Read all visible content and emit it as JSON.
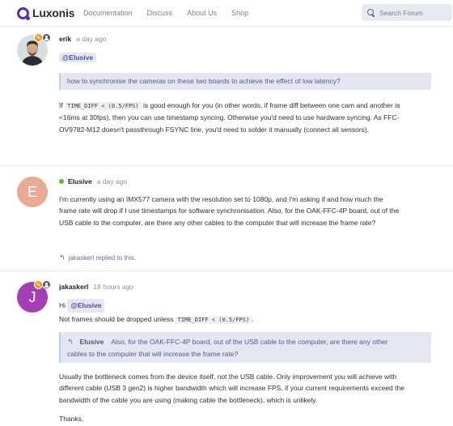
{
  "header": {
    "brand": "Luxonis",
    "nav": [
      "Documentation",
      "Discuss",
      "About Us",
      "Shop"
    ],
    "search_placeholder": "Search Forum"
  },
  "posts": [
    {
      "username": "erik",
      "time": "a day ago",
      "mention": "@Elusive",
      "quote": "how to synchronise the cameras on these two boards to achieve the effect of low latency?",
      "body": {
        "p1_before": "If ",
        "p1_code": "TIME_DIFF < (0.5/FPS)",
        "p1_after_line1": " is good enough for you (in other words, if frame diff between one cam and another is",
        "line2": "<16ms at 30fps), then you can use timestamp syncing. Otherwise you'd need to use hardware syncing. As FFC-",
        "line3": "OV9782-M12 doesn't passthrough FSYNC line, you'd need to solder it manually (connect all sensors)."
      }
    },
    {
      "username": "Elusive",
      "time": "a day ago",
      "avatar_letter": "E",
      "avatar_color": "#e8a995",
      "body": {
        "line1": "I'm currently using an IMX577 camera with the resolution set to 1080p, and I'm asking if and how much the",
        "line2": "frame rate will drop if I use timestamps for software synchronisation. Also, for the OAK-FFC-4P board, out of the",
        "line3": "USB cable to the computer, are there any other cables to the computer that will increase the frame rate?"
      },
      "replied": "jakaskerl replied to this."
    },
    {
      "username": "jakaskerl",
      "time": "18 hours ago",
      "avatar_letter": "J",
      "avatar_color": "#a43fb6",
      "greeting": "Hi",
      "mention": "@Elusive",
      "line_before_code": "Not frames should be dropped unless ",
      "code": "TIME_DIFF < (0.5/FPS)",
      "line_after_code": ".",
      "quote_user": "Elusive",
      "quote_line1": " Also, for the OAK-FFC-4P board, out of the USB cable to the computer, are there any other",
      "quote_line2": "cables to the computer that will increase the frame rate?",
      "body": {
        "line1": "Usually the bottleneck comes from the device itself, not the USB cable. Only improvement you will achieve with",
        "line2": "different cable (USB 3 gen2) is higher bandwidth which will increase FPS, if your current requirements exceed the",
        "line3": "bandwidth of the cable you are using (making cable the bottleneck), which is unlikely.",
        "thanks": "Thanks,"
      }
    }
  ],
  "colors": {
    "brand": "#5b2db8",
    "mention_bg": "#e4e7f2",
    "online": "#5fb83a"
  },
  "icons": [
    "luxonis-logo-icon",
    "search-icon",
    "pencil-badge-icon",
    "user-badge-icon",
    "reply-icon"
  ]
}
